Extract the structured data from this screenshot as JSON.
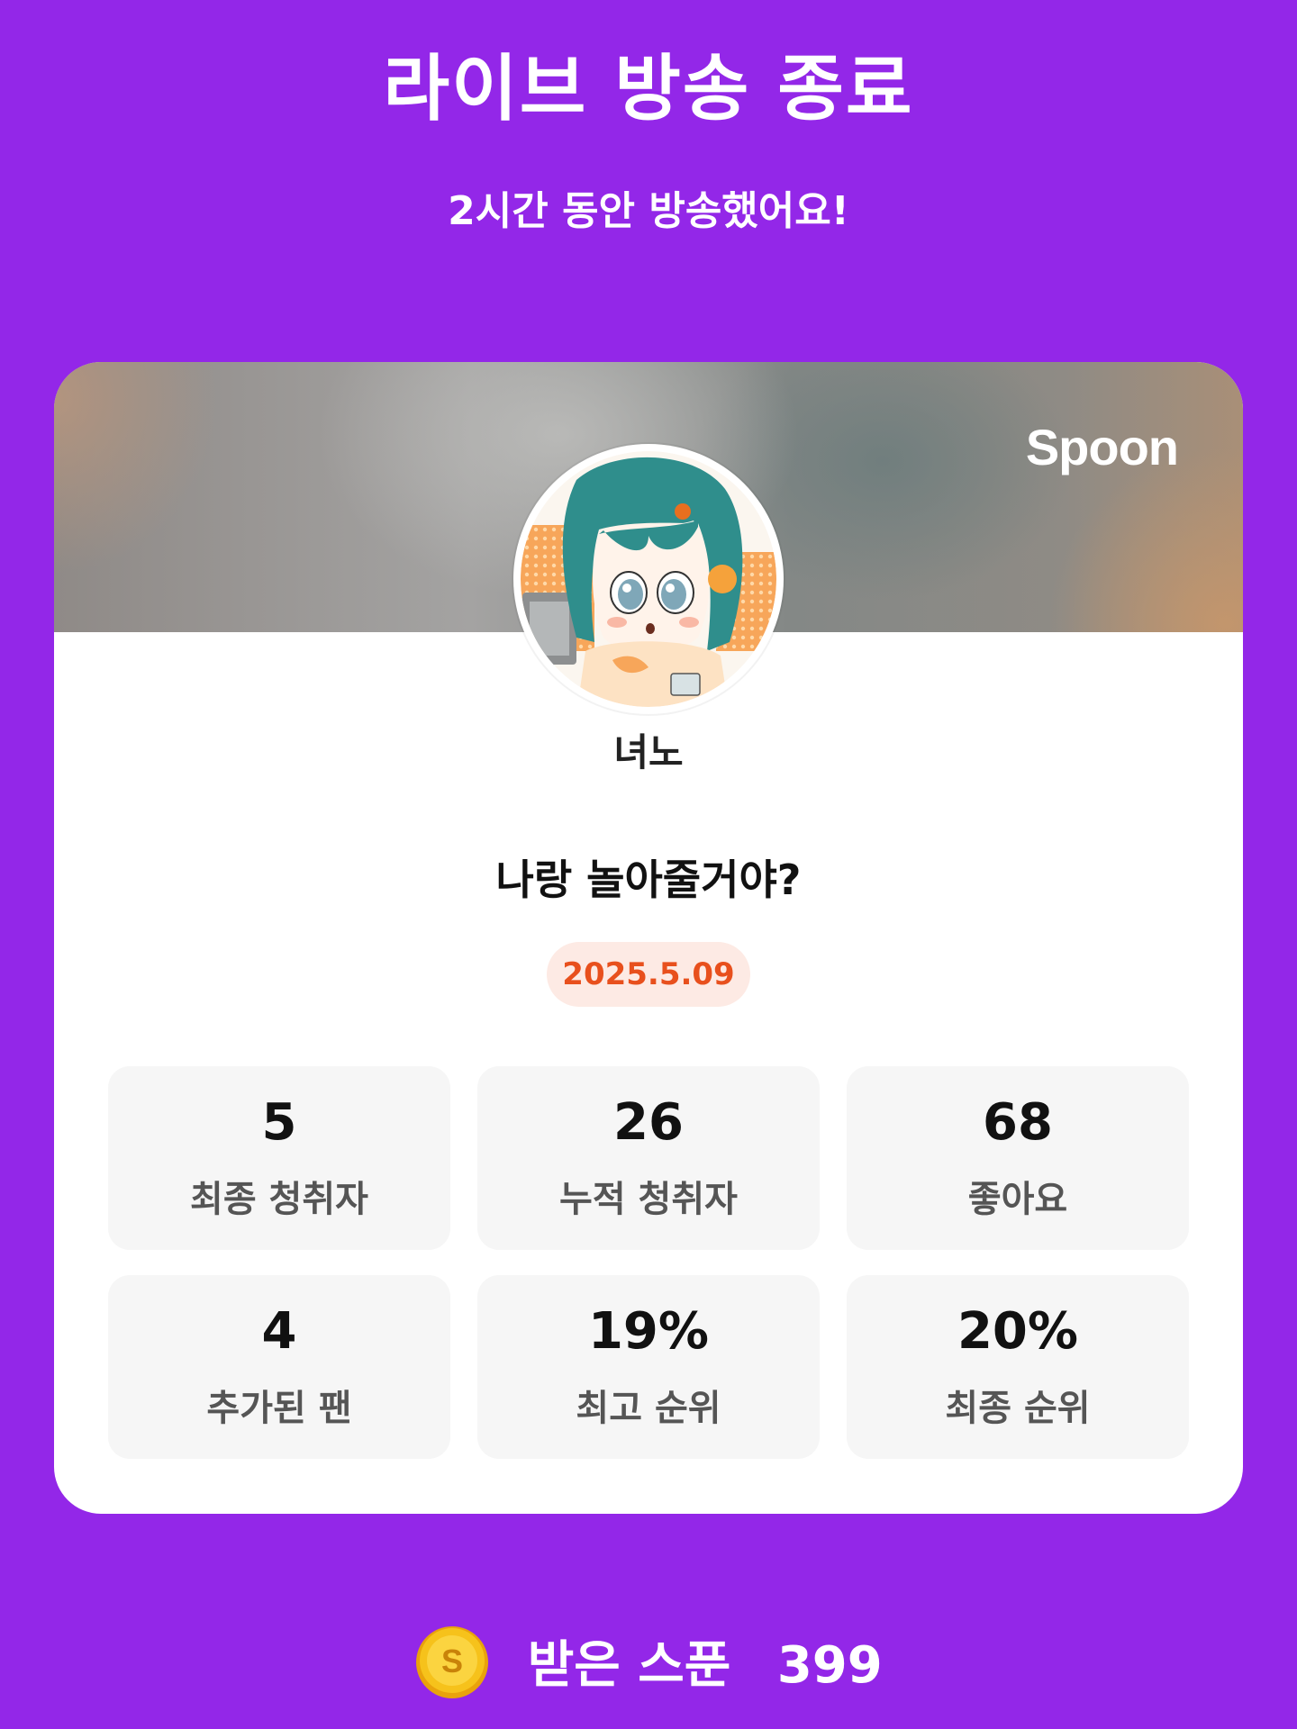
{
  "header": {
    "title": "라이브 방송 종료",
    "subtitle": "2시간 동안 방송했어요!"
  },
  "card": {
    "brand": "Spoon",
    "streamer_name": "녀노",
    "stream_title": "나랑 놀아줄거야?",
    "date": "2025.5.09",
    "stats": [
      {
        "value": "5",
        "label": "최종 청취자"
      },
      {
        "value": "26",
        "label": "누적 청취자"
      },
      {
        "value": "68",
        "label": "좋아요"
      },
      {
        "value": "4",
        "label": "추가된 팬"
      },
      {
        "value": "19%",
        "label": "최고 순위"
      },
      {
        "value": "20%",
        "label": "최종 순위"
      }
    ]
  },
  "footer": {
    "coin_icon": "coin-s-icon",
    "coin_letter": "S",
    "spoon_label": "받은 스푼",
    "spoon_count": "399"
  },
  "colors": {
    "background": "#9327e8",
    "date_text": "#e8501d",
    "date_badge_bg": "#fdeae4",
    "coin": "#f6c21b"
  }
}
